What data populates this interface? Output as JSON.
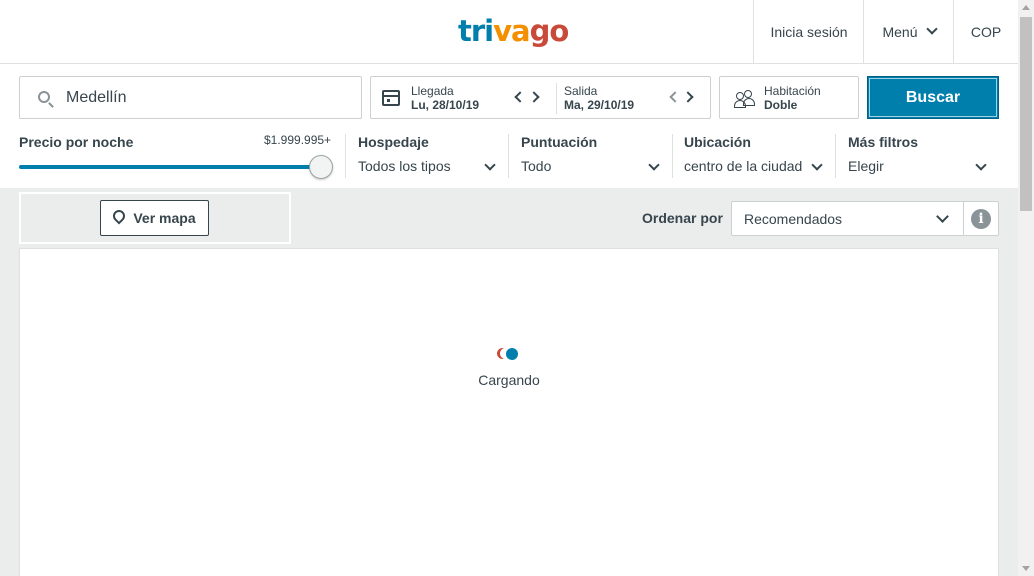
{
  "header": {
    "logo": {
      "p1": "tri",
      "p2": "va",
      "p3": "go"
    },
    "login": "Inicia sesión",
    "menu": "Menú",
    "currency": "COP"
  },
  "search": {
    "destination": "Medellín",
    "checkin_label": "Llegada",
    "checkin_value": "Lu, 28/10/19",
    "checkout_label": "Salida",
    "checkout_value": "Ma, 29/10/19",
    "room_label": "Habitación",
    "room_value": "Doble",
    "button": "Buscar"
  },
  "filters": {
    "price_label": "Precio por noche",
    "price_max": "$1.999.995+",
    "price_level": 1.0,
    "lodging_label": "Hospedaje",
    "lodging_value": "Todos los tipos",
    "rating_label": "Puntuación",
    "rating_value": "Todo",
    "location_label": "Ubicación",
    "location_value": "centro de la ciudad",
    "more_label": "Más filtros",
    "more_value": "Elegir"
  },
  "toolbar": {
    "map_button": "Ver mapa",
    "sort_label": "Ordenar por",
    "sort_value": "Recomendados",
    "info_glyph": "i"
  },
  "results": {
    "loading": "Cargando"
  },
  "colors": {
    "brand_blue": "#007fad",
    "brand_orange": "#f48f00",
    "brand_red": "#c94a38"
  }
}
